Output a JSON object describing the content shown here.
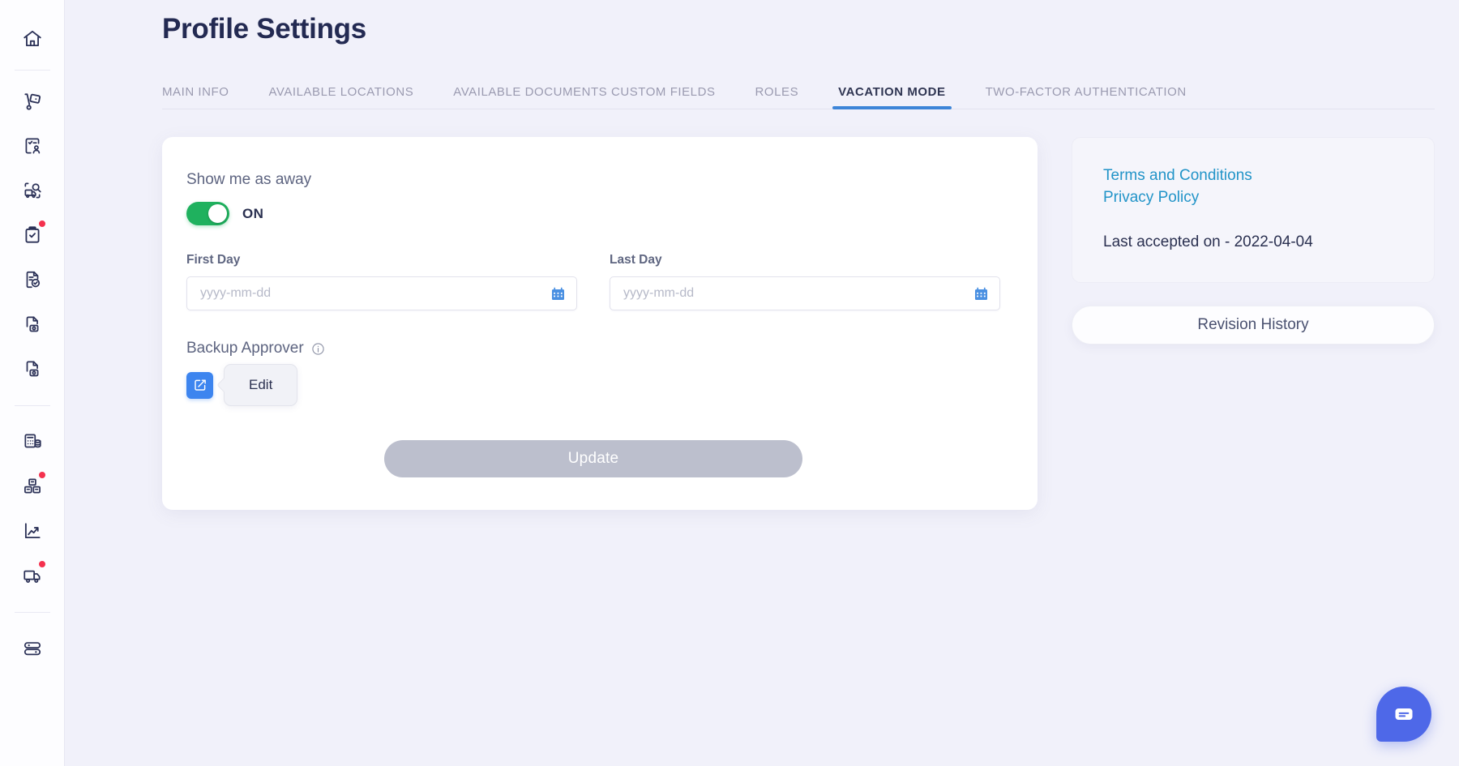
{
  "sidebar": {
    "items": [
      {
        "icon": "home-icon",
        "badge": false
      },
      {
        "icon": "hand-truck-icon",
        "badge": false
      },
      {
        "icon": "checklist-person-icon",
        "badge": false
      },
      {
        "icon": "truck-search-icon",
        "badge": false
      },
      {
        "icon": "clipboard-check-icon",
        "badge": true
      },
      {
        "icon": "document-check-icon",
        "badge": false
      },
      {
        "icon": "document-lock-icon",
        "badge": false
      },
      {
        "icon": "document-lock-alt-icon",
        "badge": false
      },
      {
        "icon": "calculator-database-icon",
        "badge": false
      },
      {
        "icon": "boxes-icon",
        "badge": true
      },
      {
        "icon": "trending-chart-icon",
        "badge": false
      },
      {
        "icon": "delivery-truck-icon",
        "badge": true
      },
      {
        "icon": "toggles-icon",
        "badge": false
      }
    ]
  },
  "header": {
    "title": "Profile Settings"
  },
  "tabs": [
    {
      "label": "MAIN INFO",
      "active": false
    },
    {
      "label": "AVAILABLE LOCATIONS",
      "active": false
    },
    {
      "label": "AVAILABLE DOCUMENTS CUSTOM FIELDS",
      "active": false
    },
    {
      "label": "ROLES",
      "active": false
    },
    {
      "label": "VACATION MODE",
      "active": true
    },
    {
      "label": "TWO-FACTOR AUTHENTICATION",
      "active": false
    }
  ],
  "vacation": {
    "away_label": "Show me as away",
    "toggle_state": "ON",
    "toggle_on": true,
    "first_day": {
      "label": "First Day",
      "value": "",
      "placeholder": "yyyy-mm-dd"
    },
    "last_day": {
      "label": "Last Day",
      "value": "",
      "placeholder": "yyyy-mm-dd"
    },
    "backup_approver": {
      "label": "Backup Approver",
      "tooltip": "Edit"
    },
    "update_label": "Update"
  },
  "side_panel": {
    "terms_link": "Terms and Conditions",
    "privacy_link": "Privacy Policy",
    "last_accepted": "Last accepted on - 2022-04-04",
    "revision_history": "Revision History"
  },
  "chat": {
    "icon": "chat-bubble-icon"
  },
  "colors": {
    "page_background": "#f1f1fa",
    "title": "#232a52",
    "tab_active": "#2f3552",
    "tab_inactive": "#9a9ab0",
    "tab_underline": "#3d85d8",
    "toggle_on": "#1fb15e",
    "edit_button": "#3d85ef",
    "calendar_icon": "#4a90e2",
    "link": "#2294c8",
    "update_disabled": "#bcbfcd",
    "badge": "#f4314e",
    "chat_widget": "#4e68e8"
  }
}
